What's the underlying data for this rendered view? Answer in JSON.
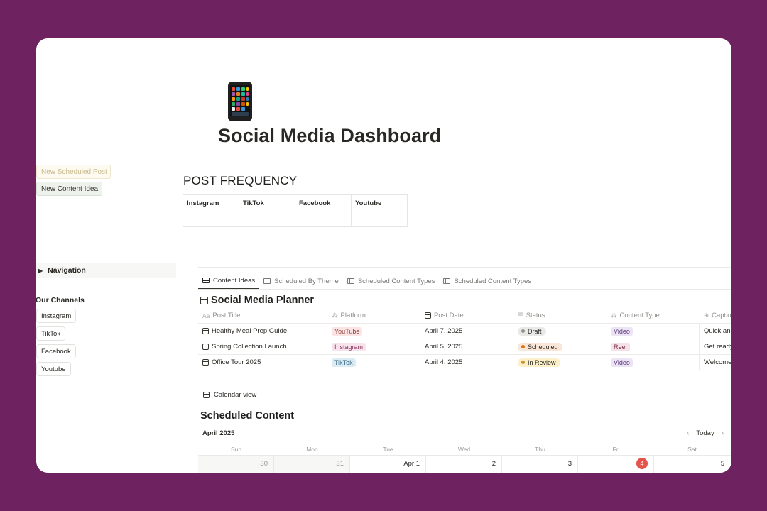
{
  "page": {
    "title": "Social Media Dashboard",
    "emoji": "📱"
  },
  "buttons": {
    "new_scheduled_post": "New Scheduled Post",
    "new_content_idea": "New Content Idea"
  },
  "post_frequency": {
    "heading": "POST FREQUENCY",
    "columns": [
      "Instagram",
      "TikTok",
      "Facebook",
      "Youtube"
    ]
  },
  "sidebar": {
    "navigation": "Navigation",
    "channels_title": "Our Channels",
    "channels": [
      "Instagram",
      "TikTok",
      "Facebook",
      "Youtube"
    ]
  },
  "tabs": [
    "Content Ideas",
    "Scheduled By Theme",
    "Scheduled Content Types",
    "Scheduled Content Types"
  ],
  "planner": {
    "title": "Social Media Planner",
    "columns": [
      "Post Title",
      "Platform",
      "Post Date",
      "Status",
      "Content Type",
      "Caption"
    ],
    "rows": [
      {
        "title": "Healthy Meal Prep Guide",
        "platform": "YouTube",
        "date": "April 7, 2025",
        "status": "Draft",
        "type": "Video",
        "caption": "Quick and"
      },
      {
        "title": "Spring Collection Launch",
        "platform": "Instagram",
        "date": "April 5, 2025",
        "status": "Scheduled",
        "type": "Reel",
        "caption": "Get ready"
      },
      {
        "title": "Office Tour 2025",
        "platform": "TikTok",
        "date": "April 4, 2025",
        "status": "In Review",
        "type": "Video",
        "caption": "Welcome"
      }
    ]
  },
  "calendar": {
    "view_label": "Calendar view",
    "title": "Scheduled Content",
    "month": "April 2025",
    "today_label": "Today",
    "weekdays": [
      "Sun",
      "Mon",
      "Tue",
      "Wed",
      "Thu",
      "Fri",
      "Sat"
    ],
    "days": [
      "30",
      "31",
      "Apr 1",
      "2",
      "3",
      "4",
      "5"
    ],
    "today": "4"
  },
  "colors": {
    "background": "#6e2260",
    "tag_youtube": "#fbe4e4",
    "tag_instagram": "#f8e2ec",
    "tag_tiktok": "#dcecf5",
    "status_draft": "#e9e9e7",
    "status_scheduled": "#fae6d8",
    "status_review": "#fbf0c9",
    "tag_video": "#ece3f4",
    "tag_reel": "#f5e1e8",
    "today": "#e5534b"
  }
}
